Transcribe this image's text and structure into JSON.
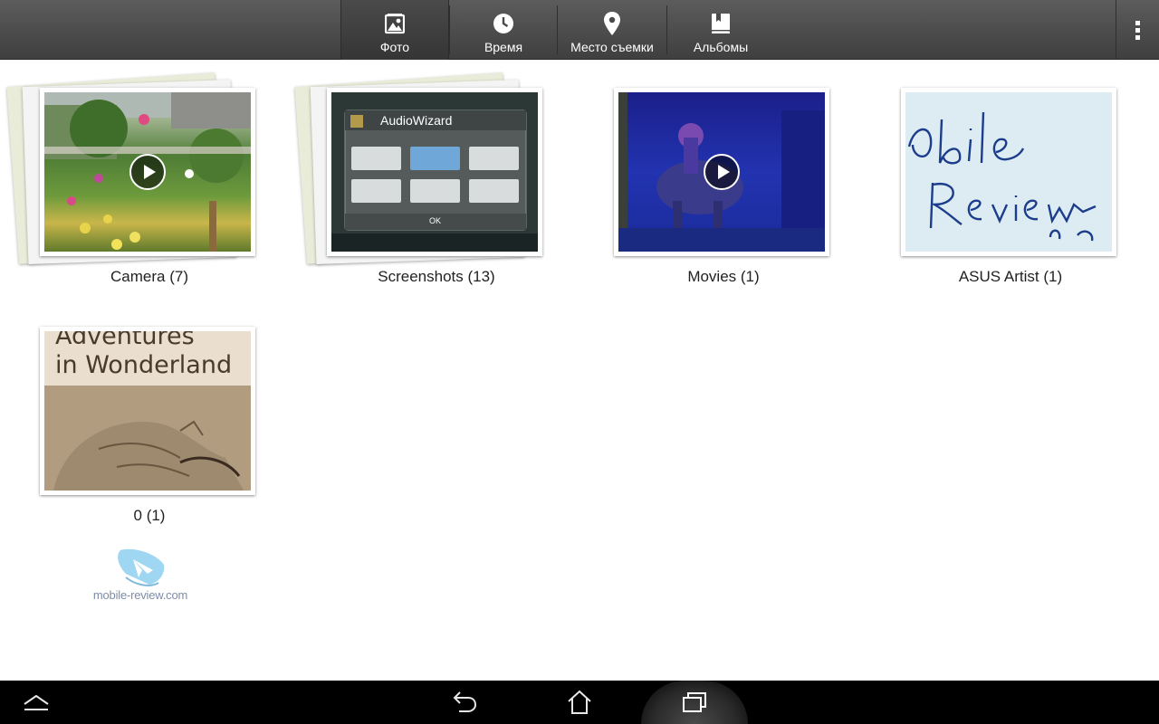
{
  "tabs": [
    {
      "label": "Фото",
      "icon": "photo-icon",
      "active": true
    },
    {
      "label": "Время",
      "icon": "clock-icon",
      "active": false
    },
    {
      "label": "Место съемки",
      "icon": "location-pin-icon",
      "active": false
    },
    {
      "label": "Альбомы",
      "icon": "album-book-icon",
      "active": false
    }
  ],
  "overflow_icon": "overflow-menu-icon",
  "albums": [
    {
      "caption": "Camera (7)",
      "is_video": true,
      "stacked": true
    },
    {
      "caption": "Screenshots (13)",
      "is_video": false,
      "stacked": true,
      "screenshot_title": "AudioWizard",
      "screenshot_ok": "OK"
    },
    {
      "caption": "Movies (1)",
      "is_video": true,
      "stacked": false
    },
    {
      "caption": "ASUS Artist (1)",
      "is_video": false,
      "stacked": false
    },
    {
      "caption": "0 (1)",
      "is_video": false,
      "stacked": false,
      "book_text_1": "Adventures",
      "book_text_2": "in Wonderland"
    }
  ],
  "watermark": {
    "text": "mobile-review.com"
  },
  "navbar": {
    "icons": [
      "collapse-up-icon",
      "back-icon",
      "home-icon",
      "recent-apps-icon"
    ]
  },
  "colors": {
    "topbar": "#4d4d4d",
    "background": "#ffffff",
    "navbar": "#000000",
    "accent_watermark": "#7d8da8"
  }
}
